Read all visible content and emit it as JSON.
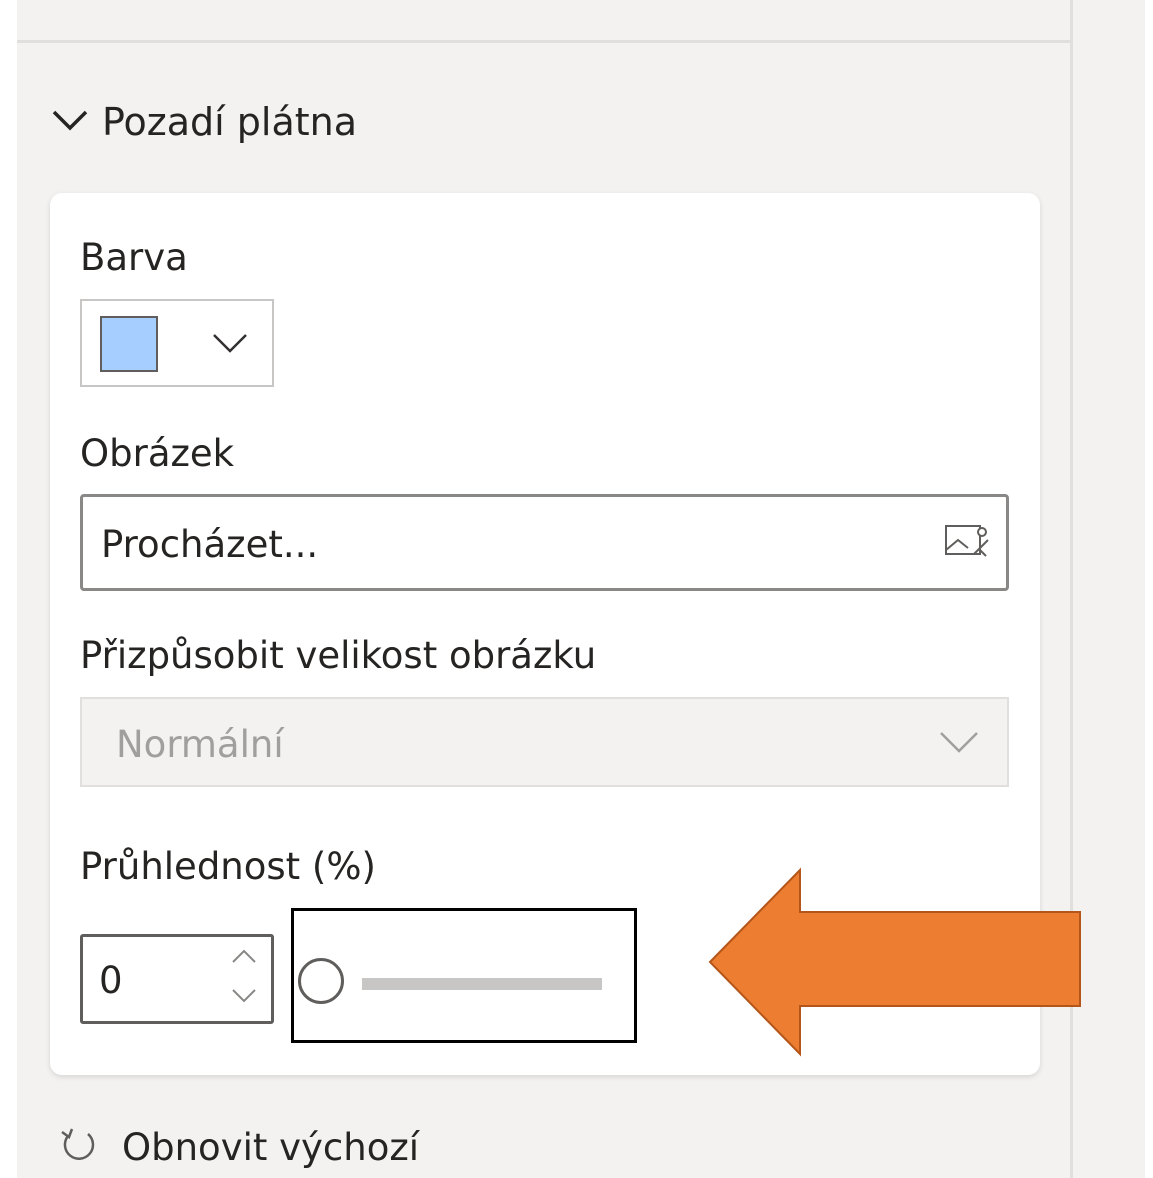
{
  "section": {
    "title": "Pozadí plátna",
    "expanded": true
  },
  "color": {
    "label": "Barva",
    "swatch_color": "#a6cfff"
  },
  "image": {
    "label": "Obrázek",
    "browse_text": "Procházet..."
  },
  "fit": {
    "label": "Přizpůsobit velikost obrázku",
    "value": "Normální"
  },
  "transparency": {
    "label": "Průhlednost (%)",
    "value": "0",
    "slider_level": 0
  },
  "reset": {
    "label": "Obnovit výchozí"
  },
  "annotation": {
    "arrow_color": "#ed7d31",
    "box_color": "#000000"
  },
  "icons": {
    "section_toggle": "chevron-down-icon",
    "color_dropdown": "chevron-down-icon",
    "browse": "image-icon",
    "select_dropdown": "chevron-down-icon",
    "spin_up": "chevron-up-icon",
    "spin_down": "chevron-down-icon",
    "reset": "undo-icon"
  }
}
